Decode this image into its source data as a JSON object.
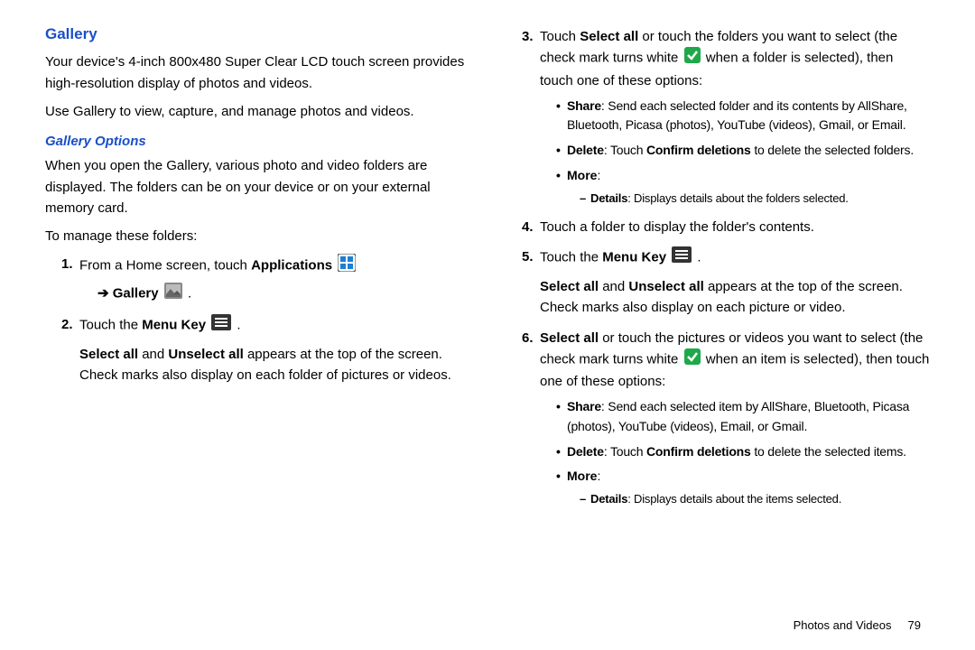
{
  "headings": {
    "gallery": "Gallery",
    "galleryOptions": "Gallery Options"
  },
  "left": {
    "intro1": "Your device's 4-inch 800x480 Super Clear LCD touch screen provides high-resolution display of photos and videos.",
    "intro2": "Use Gallery to view, capture, and manage photos and videos.",
    "optionsIntro": "When you open the Gallery, various photo and video folders are displayed. The folders can be on your device or on your external memory card.",
    "toManage": "To manage these folders:",
    "step1_a": "From a Home screen, touch ",
    "step1_b": "Applications",
    "step1_c": "Gallery",
    "step2_a": "Touch the ",
    "step2_b": "Menu Key",
    "step2_after_a": "Select all",
    "step2_after_b": " and ",
    "step2_after_c": "Unselect all",
    "step2_after_d": " appears at the top of the screen. Check marks also display on each folder of pictures or videos."
  },
  "right": {
    "step3_a": "Touch ",
    "step3_b": "Select all",
    "step3_c": " or touch the folders you want to select (the check mark turns white ",
    "step3_d": " when a folder is selected), then touch one of these options:",
    "b_share_lbl": "Share",
    "b_share_txt": ": Send each selected folder and its contents by AllShare, Bluetooth, Picasa (photos), YouTube (videos), Gmail, or Email.",
    "b_delete_lbl": "Delete",
    "b_delete_txt_a": ": Touch ",
    "b_delete_txt_b": "Confirm deletions",
    "b_delete_txt_c": " to delete the selected folders.",
    "b_more_lbl": "More",
    "b_more_colon": ":",
    "b_more_details_lbl": "Details",
    "b_more_details_txt": ": Displays details about the folders selected.",
    "step4": "Touch a folder to display the folder's contents.",
    "step5_a": "Touch the ",
    "step5_b": "Menu Key",
    "step5_after_a": "Select all",
    "step5_after_b": " and ",
    "step5_after_c": "Unselect all",
    "step5_after_d": " appears at the top of the screen. Check marks also display on each picture or video.",
    "step6_a": "Select all",
    "step6_b": " or touch the pictures or videos you want to select (the check mark turns white ",
    "step6_c": " when an item is selected), then touch one of these options:",
    "b2_share_lbl": "Share",
    "b2_share_txt": ": Send each selected item by AllShare, Bluetooth, Picasa (photos), YouTube (videos), Email, or Gmail.",
    "b2_delete_lbl": "Delete",
    "b2_delete_txt_a": ": Touch ",
    "b2_delete_txt_b": "Confirm deletions",
    "b2_delete_txt_c": " to delete the selected items.",
    "b2_more_lbl": "More",
    "b2_more_colon": ":",
    "b2_more_details_lbl": "Details",
    "b2_more_details_txt": ": Displays details about the items selected."
  },
  "footer": {
    "section": "Photos and Videos",
    "page": "79"
  }
}
